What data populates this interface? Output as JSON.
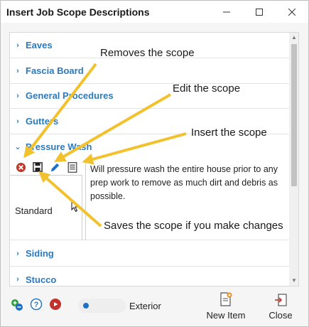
{
  "window": {
    "title": "Insert Job Scope Descriptions",
    "minimize_icon": "minimize-icon",
    "maximize_icon": "maximize-icon",
    "close_icon": "close-icon"
  },
  "categories": [
    {
      "label": "Eaves",
      "expanded": false
    },
    {
      "label": "Fascia Board",
      "expanded": false
    },
    {
      "label": "General Procedures",
      "expanded": false
    },
    {
      "label": "Gutters",
      "expanded": false
    },
    {
      "label": "Pressure Wash",
      "expanded": true
    },
    {
      "label": "Siding",
      "expanded": false
    },
    {
      "label": "Stucco",
      "expanded": false
    }
  ],
  "scope": {
    "name": "Standard",
    "description": "Will pressure wash the entire house prior to any prep work to remove as much dirt and debris as possible.",
    "actions": [
      "remove-icon",
      "save-icon",
      "edit-icon",
      "insert-icon"
    ]
  },
  "callouts": {
    "remove": "Removes the scope",
    "edit": "Edit the scope",
    "insert": "Insert the scope",
    "save": "Saves the scope if you make changes"
  },
  "footer": {
    "toggle_label": "Exterior",
    "new_item_label": "New Item",
    "close_label": "Close"
  },
  "colors": {
    "accent": "#2a7ac0",
    "arrow": "#f2c12e",
    "remove": "#c0392b",
    "toggle_knob": "#1e6fc8"
  }
}
